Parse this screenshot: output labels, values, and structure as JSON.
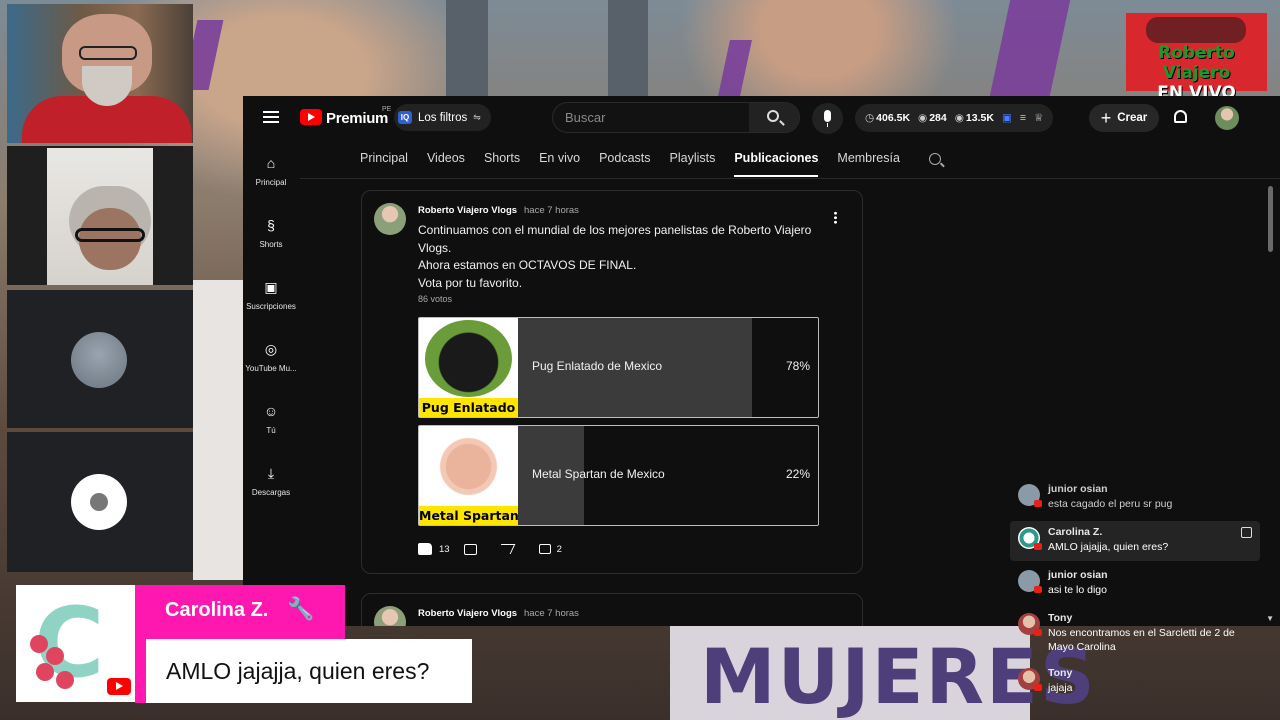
{
  "brand": {
    "line1": "Roberto Viajero",
    "line2": "EN VIVO",
    "color": "#d9272e"
  },
  "youtube": {
    "brand": "Premium",
    "region": "PE",
    "filters_label": "Los filtros",
    "filters_badge": "IQ",
    "search_placeholder": "Buscar",
    "stats": {
      "subscribers": "406.5K",
      "views": "284",
      "watching": "13.5K"
    },
    "create_label": "Crear",
    "tabs": [
      "Principal",
      "Videos",
      "Shorts",
      "En vivo",
      "Podcasts",
      "Playlists",
      "Publicaciones",
      "Membresía"
    ],
    "active_tab": "Publicaciones",
    "guide": [
      {
        "label": "Principal",
        "icon": "home-icon",
        "glyph": "⌂"
      },
      {
        "label": "Shorts",
        "icon": "shorts-icon",
        "glyph": "§"
      },
      {
        "label": "Suscripciones",
        "icon": "subscriptions-icon",
        "glyph": "▣"
      },
      {
        "label": "YouTube Mu...",
        "icon": "music-icon",
        "glyph": "◎"
      },
      {
        "label": "Tú",
        "icon": "you-icon",
        "glyph": "☺"
      },
      {
        "label": "Descargas",
        "icon": "download-icon",
        "glyph": "⤓"
      }
    ]
  },
  "post": {
    "channel": "Roberto Viajero Vlogs",
    "time": "hace 7 horas",
    "lines": [
      "Continuamos con el mundial de los mejores panelistas de Roberto Viajero Vlogs.",
      "Ahora estamos en OCTAVOS DE FINAL.",
      "Vota por tu favorito."
    ],
    "votes": "86 votos",
    "options": [
      {
        "caption": "Pug Enlatado",
        "label": "Pug Enlatado de Mexico",
        "percent": "78%",
        "fraction": 0.78
      },
      {
        "caption": "Metal Spartan",
        "label": "Metal Spartan de Mexico",
        "percent": "22%",
        "fraction": 0.22
      }
    ],
    "likes": "13",
    "comments": "2"
  },
  "post2": {
    "channel": "Roberto Viajero Vlogs",
    "time": "hace 7 horas"
  },
  "chat": [
    {
      "name": "junior osian",
      "text": "esta cagado el peru sr pug",
      "style": "faded"
    },
    {
      "name": "Carolina Z.",
      "text": "AMLO jajajja, quien eres?",
      "style": "hl"
    },
    {
      "name": "junior osian",
      "text": "asi te lo digo",
      "style": ""
    },
    {
      "name": "Tony",
      "text": "Nos encontramos en el Sarcletti de 2 de Mayo Carolina",
      "style": ""
    },
    {
      "name": "Tony",
      "text": "jajaja",
      "style": ""
    }
  ],
  "lower_third": {
    "name": "Carolina Z.",
    "message": "AMLO jajajja, quien eres?",
    "accent": "#ff18b0"
  },
  "background_sign": "MUJERES"
}
